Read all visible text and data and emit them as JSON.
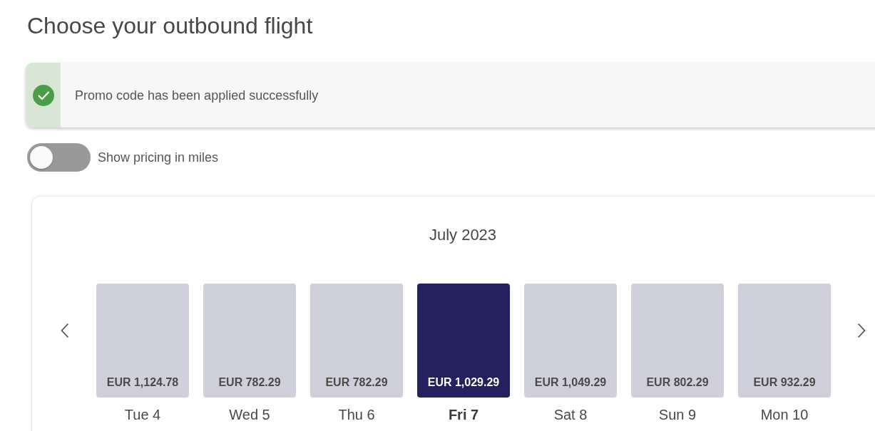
{
  "page": {
    "title": "Choose your outbound flight"
  },
  "alert": {
    "kind": "success",
    "message": "Promo code has been applied successfully"
  },
  "miles_toggle": {
    "label": "Show pricing in miles",
    "on": false
  },
  "calendar": {
    "month": "July 2023",
    "days": [
      {
        "label": "Tue 4",
        "price": "EUR 1,124.78",
        "selected": false
      },
      {
        "label": "Wed 5",
        "price": "EUR 782.29",
        "selected": false
      },
      {
        "label": "Thu 6",
        "price": "EUR 782.29",
        "selected": false
      },
      {
        "label": "Fri 7",
        "price": "EUR 1,029.29",
        "selected": true
      },
      {
        "label": "Sat 8",
        "price": "EUR 1,049.29",
        "selected": false
      },
      {
        "label": "Sun 9",
        "price": "EUR 802.29",
        "selected": false
      },
      {
        "label": "Mon 10",
        "price": "EUR 932.29",
        "selected": false
      }
    ]
  }
}
